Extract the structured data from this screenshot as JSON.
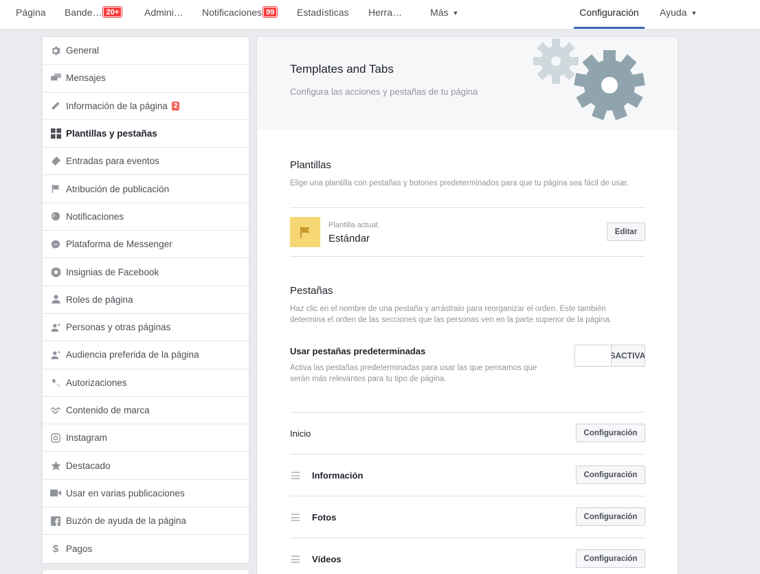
{
  "topnav": {
    "items": [
      {
        "label": "Página"
      },
      {
        "label": "Bande…",
        "badge": "20+"
      },
      {
        "label": "Admini…"
      },
      {
        "label": "Notificaciones",
        "badge": "99"
      },
      {
        "label": "Estadísticas"
      },
      {
        "label": "Herra…"
      },
      {
        "label": "Más"
      },
      {
        "label": "Configuración",
        "active": true
      },
      {
        "label": "Ayuda"
      }
    ]
  },
  "sidebar": {
    "items": [
      {
        "label": "General",
        "icon": "gear-icon"
      },
      {
        "label": "Mensajes",
        "icon": "messages-icon"
      },
      {
        "label": "Información de la página",
        "icon": "pencil-icon",
        "badge": "2"
      },
      {
        "label": "Plantillas y pestañas",
        "icon": "grid-icon",
        "active": true
      },
      {
        "label": "Entradas para eventos",
        "icon": "ticket-icon"
      },
      {
        "label": "Atribución de publicación",
        "icon": "flag-icon"
      },
      {
        "label": "Notificaciones",
        "icon": "globe-icon"
      },
      {
        "label": "Plataforma de Messenger",
        "icon": "messenger-icon"
      },
      {
        "label": "Insignias de Facebook",
        "icon": "badge-star-icon"
      },
      {
        "label": "Roles de página",
        "icon": "person-icon"
      },
      {
        "label": "Personas y otras páginas",
        "icon": "person-star-icon"
      },
      {
        "label": "Audiencia preferida de la página",
        "icon": "person-star-icon"
      },
      {
        "label": "Autorizaciones",
        "icon": "wrench-icon"
      },
      {
        "label": "Contenido de marca",
        "icon": "handshake-icon"
      },
      {
        "label": "Instagram",
        "icon": "instagram-icon"
      },
      {
        "label": "Destacado",
        "icon": "star-icon"
      },
      {
        "label": "Usar en varias publicaciones",
        "icon": "video-camera-icon"
      },
      {
        "label": "Buzón de ayuda de la página",
        "icon": "facebook-icon"
      },
      {
        "label": "Pagos",
        "icon": "dollar-icon"
      }
    ]
  },
  "main": {
    "header": {
      "title": "Templates and Tabs",
      "subtitle": "Configura las acciones y pestañas de tu página"
    },
    "templates": {
      "title": "Plantillas",
      "description": "Elige una plantilla con pestañas y botones predeterminados para que tu página sea fácil de usar.",
      "current_label": "Plantilla actual:",
      "current_value": "Estándar",
      "edit_button": "Editar"
    },
    "tabs": {
      "title": "Pestañas",
      "description_line1": "Haz clic en el nombre de una pestaña y arrástralo para reorganizar el orden. Este también",
      "description_line2": "determina el orden de las secciones que las personas ven en la parte superior de la página.",
      "default_tabs_label": "Usar pestañas predeterminadas",
      "default_tabs_desc_line1": "Activa las pestañas predeterminadas para usar las que pensamos que",
      "default_tabs_desc_line2": "serán más relevantes para tu tipo de página.",
      "toggle_state": "DESACTIVADO",
      "rows": [
        {
          "label": "Inicio",
          "button": "Configuración",
          "draggable": false
        },
        {
          "label": "Información",
          "button": "Configuración",
          "draggable": true
        },
        {
          "label": "Fotos",
          "button": "Configuración",
          "draggable": true
        },
        {
          "label": "Vídeos",
          "button": "Configuración",
          "draggable": true
        }
      ]
    }
  },
  "colors": {
    "accent": "#4267b2",
    "badge_red": "#fa3e3e",
    "template_icon_bg": "#f7d774",
    "gear_dark": "#90a4ae",
    "gear_light": "#cfd8dc"
  }
}
